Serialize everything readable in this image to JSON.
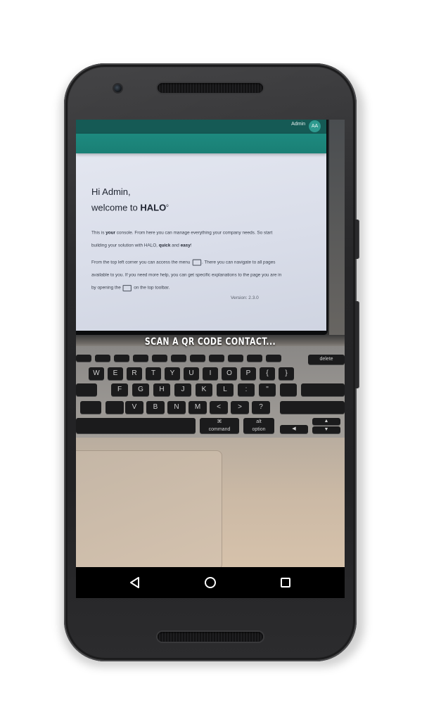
{
  "halo_console": {
    "user_name": "Admin",
    "user_initials": "AA",
    "greeting_line": "Hi Admin,",
    "welcome_prefix": "welcome to ",
    "brand_name": "HALO",
    "brand_mark": "o",
    "para1_a": "This is ",
    "para1_b": "your",
    "para1_c": " console. From here you can manage everything your company needs. So start building your solution with HALO, ",
    "para1_d": "quick",
    "para1_e": " and ",
    "para1_f": "easy",
    "para1_g": "!",
    "para2_a": "From the top left corner you can access the menu ",
    "para2_b": ". There you can navigate to all pages available to you. If you need more help, you can get specific explanations to the page you are in by opening the ",
    "para2_c": " on the top toolbar.",
    "version": "Version: 2.3.0"
  },
  "scanner": {
    "prompt": "Scan a QR code contact..."
  },
  "keyboard": {
    "row1": [
      "",
      "",
      "",
      "",
      "",
      "",
      "",
      "",
      "",
      "",
      "",
      "delete"
    ],
    "row2": [
      "W",
      "E",
      "R",
      "T",
      "Y",
      "U",
      "I",
      "O",
      "P",
      "{",
      "}"
    ],
    "row3": [
      "F",
      "G",
      "H",
      "J",
      "K",
      "L",
      ":",
      "\""
    ],
    "row4": [
      "V",
      "B",
      "N",
      "M",
      "<",
      ">",
      "?"
    ],
    "row5": [
      "⌘",
      "command",
      "alt",
      "option",
      "◀",
      "▲",
      "▼"
    ]
  },
  "navigation": {
    "back_icon": "back-triangle",
    "home_icon": "home-circle",
    "recents_icon": "recents-square"
  }
}
